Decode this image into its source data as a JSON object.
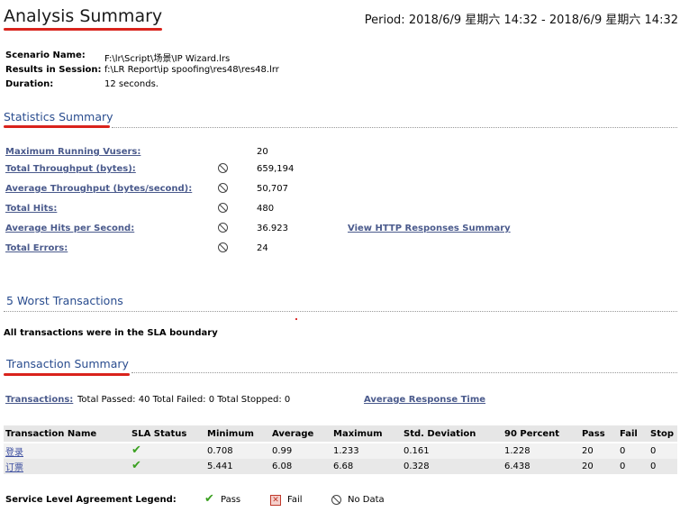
{
  "header": {
    "title": "Analysis Summary",
    "period": "Period: 2018/6/9 星期六 14:32 - 2018/6/9 星期六 14:32"
  },
  "info": {
    "scenario_label": "Scenario Name:",
    "scenario_value": "F:\\lr\\Script\\场景\\IP Wizard.lrs",
    "results_label": "Results in Session:",
    "results_value": "f:\\LR Report\\ip spoofing\\res48\\res48.lrr",
    "duration_label": "Duration:",
    "duration_value": "12 seconds."
  },
  "statistics": {
    "title": "Statistics Summary",
    "items": [
      {
        "label": "Maximum Running Vusers:",
        "value": "20"
      },
      {
        "label": "Total Throughput (bytes):",
        "value": "659,194"
      },
      {
        "label": "Average Throughput (bytes/second):",
        "value": "50,707"
      },
      {
        "label": "Total Hits:",
        "value": "480"
      },
      {
        "label": "Average Hits per Second:",
        "value": "36.923"
      },
      {
        "label": "Total Errors:",
        "value": "24"
      }
    ],
    "http_link": "View HTTP Responses Summary"
  },
  "worst": {
    "title": "5 Worst Transactions",
    "message": "All transactions were in the SLA boundary"
  },
  "transactions": {
    "title": "Transaction Summary",
    "link_label": "Transactions:",
    "summary_text": "Total Passed: 40 Total Failed: 0 Total Stopped: 0",
    "avg_link": "Average Response Time",
    "columns": [
      "Transaction Name",
      "SLA Status",
      "Minimum",
      "Average",
      "Maximum",
      "Std. Deviation",
      "90 Percent",
      "Pass",
      "Fail",
      "Stop"
    ],
    "rows": [
      {
        "name": "登录",
        "min": "0.708",
        "avg": "0.99",
        "max": "1.233",
        "std": "0.161",
        "p90": "1.228",
        "pass": "20",
        "fail": "0",
        "stop": "0"
      },
      {
        "name": "订票",
        "min": "5.441",
        "avg": "6.08",
        "max": "6.68",
        "std": "0.328",
        "p90": "6.438",
        "pass": "20",
        "fail": "0",
        "stop": "0"
      }
    ]
  },
  "legend": {
    "title": "Service Level Agreement Legend:",
    "pass": "Pass",
    "fail": "Fail",
    "nodata": "No Data"
  },
  "colors": {
    "underline": "#d9231c",
    "section_title": "#2a4d8f",
    "link": "#4a5a8c"
  }
}
